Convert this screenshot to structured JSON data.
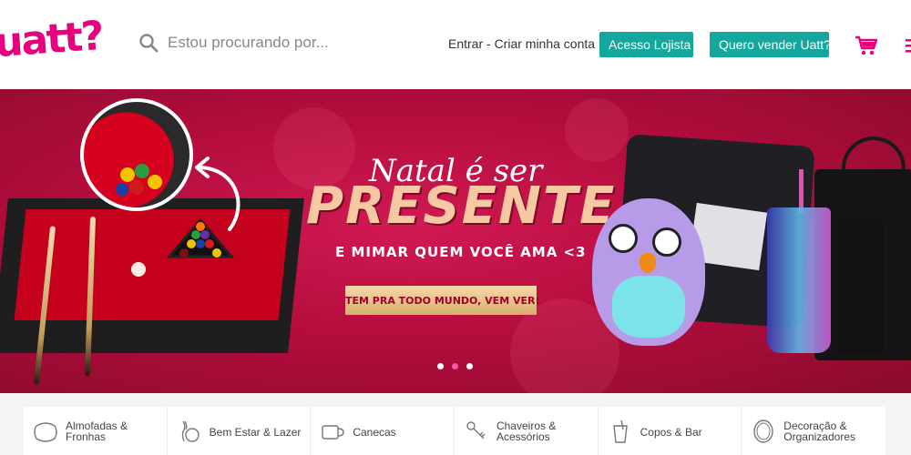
{
  "header": {
    "logo": "uatt?",
    "search": {
      "placeholder": "Estou procurando por...",
      "value": ""
    },
    "login_link": "Entrar - Criar minha conta",
    "btn_lojista": "Acesso Lojista",
    "btn_vender": "Quero vender Uatt?"
  },
  "banner": {
    "headline_script": "Natal é ser",
    "headline_main": "PRESENTE",
    "subtitle": "E MIMAR QUEM VOCÊ AMA <3",
    "cta": "TEM PRA TODO MUNDO, VEM VER!",
    "active_slide": 2,
    "slide_count": 3
  },
  "categories": [
    {
      "label": "Almofadas &\nFronhas",
      "icon": "pillow-icon"
    },
    {
      "label": "Bem Estar & Lazer",
      "icon": "bowling-icon"
    },
    {
      "label": "Canecas",
      "icon": "mug-icon"
    },
    {
      "label": "Chaveiros &\nAcessórios",
      "icon": "keychain-icon"
    },
    {
      "label": "Copos & Bar",
      "icon": "cup-icon"
    },
    {
      "label": "Decoração &\nOrganizadores",
      "icon": "mirror-icon"
    }
  ],
  "colors": {
    "brand_pink": "#e6007e",
    "teal": "#14a79d",
    "banner_red": "#c8154a",
    "cta_gold": "#e6c48d"
  }
}
